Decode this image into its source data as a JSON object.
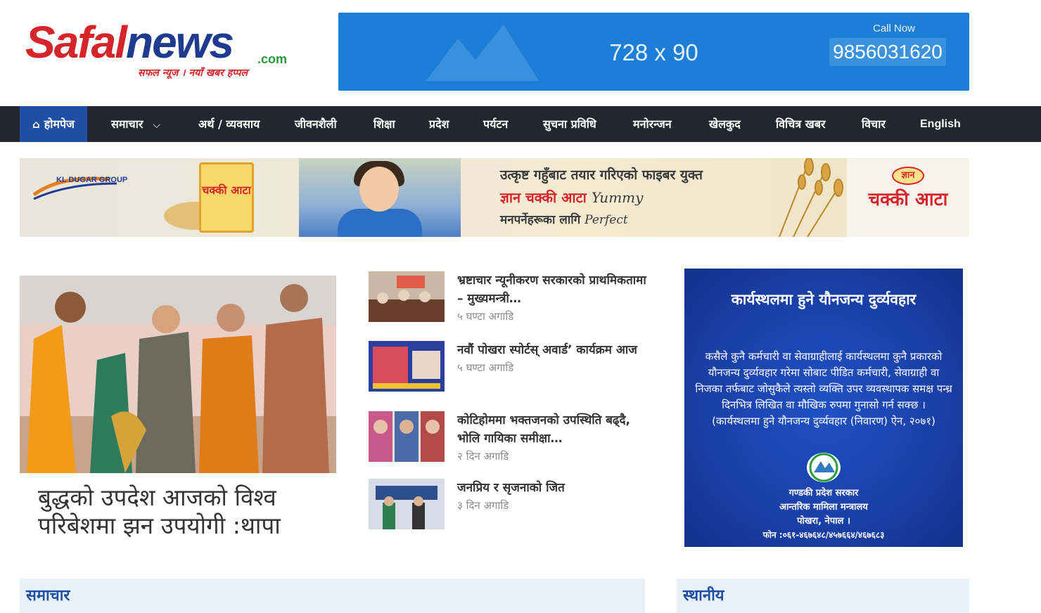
{
  "header": {
    "logo": {
      "safal": "Safal",
      "news": "news",
      "com": ".com",
      "tagline": "सफल न्यूज । नयाँ खबर हप्पल"
    },
    "top_ad": {
      "size_text": "728 x 90",
      "call_label": "Call Now",
      "phone": "9856031620",
      "color": "#1c7ed6"
    }
  },
  "nav": {
    "items": [
      {
        "label": "होमपेज",
        "icon": "home-icon"
      },
      {
        "label": "समाचार",
        "icon": "chevron-down-icon"
      },
      {
        "label": "अर्थ / व्यवसाय"
      },
      {
        "label": "जीवनशैली"
      },
      {
        "label": "शिक्षा"
      },
      {
        "label": "प्रदेश"
      },
      {
        "label": "पर्यटन"
      },
      {
        "label": "सुचना प्रविधि"
      },
      {
        "label": "मनोरन्जन"
      },
      {
        "label": "खेलकुद"
      },
      {
        "label": "विचित्र खबर"
      },
      {
        "label": "विचार"
      },
      {
        "label": "English"
      }
    ],
    "background": "#24262f",
    "active_color": "#1e4fa3"
  },
  "banner": {
    "company": "KL DUGAR GROUP",
    "pack_label": "चक्की आटा",
    "line1": "उत्कृष्ट गहुँबाट तयार गरिएको फाइबर युक्त",
    "line2": "ज्ञान चक्की आटा",
    "line2_extra": "Yummy",
    "line3": "मनपर्नेहरूका लागि",
    "line3_extra": "Perfect",
    "brand_small": "ज्ञान",
    "brand_big": "चक्की आटा"
  },
  "lead": {
    "title": "बुद्धको उपदेश आजको विश्व परिबेशमा झन उपयोगी :थापा"
  },
  "side_news": [
    {
      "title": "भ्रष्टाचार न्यूनीकरण सरकारको प्राथमिकतामा – मुख्यमन्त्री…",
      "time": "५ घण्टा अगाडि"
    },
    {
      "title": "नवौं पोखरा स्पोर्टस् अवार्ड’ कार्यक्रम आज",
      "time": "५ घण्टा अगाडि"
    },
    {
      "title": "कोटिहोममा भक्तजनको उपस्थिति बढ्दै, भोलि गायिका समीक्षा…",
      "time": "२ दिन अगाडि"
    },
    {
      "title": "जनप्रिय र सृजनाको जित",
      "time": "३ दिन अगाडि"
    }
  ],
  "right_ad": {
    "title": "कार्यस्थलमा हुने यौनजन्य दुर्व्यवहार",
    "body": "कसैले कुनै कर्मचारी वा सेवाग्राहीलाई कार्यस्थलमा कुनै प्रकारको यौनजन्य दुर्व्यवहार गरेमा सोबाट पीडित कर्मचारी, सेवाग्राही वा निजका तर्फबाट जोसुकैले त्यस्तो व्यक्ति उपर व्यवस्थापक समक्ष पन्ध्र दिनभित्र लिखित वा मौखिक रुपमा गुनासो गर्न सक्छ ।",
    "act": "(कार्यस्थलमा हुने यौनजन्य दुर्व्यवहार (निवारण) ऐन, २०७१)",
    "gov1": "गण्डकी प्रदेश सरकार",
    "gov2": "आन्तरिक मामिला मन्त्रालय",
    "gov3": "पोखरा, नेपाल ।",
    "phone": "फोन :०६१-४६७६४८/४५७६६४/४६७६८३"
  },
  "sections": {
    "news": "समाचार",
    "local": "स्थानीय"
  }
}
